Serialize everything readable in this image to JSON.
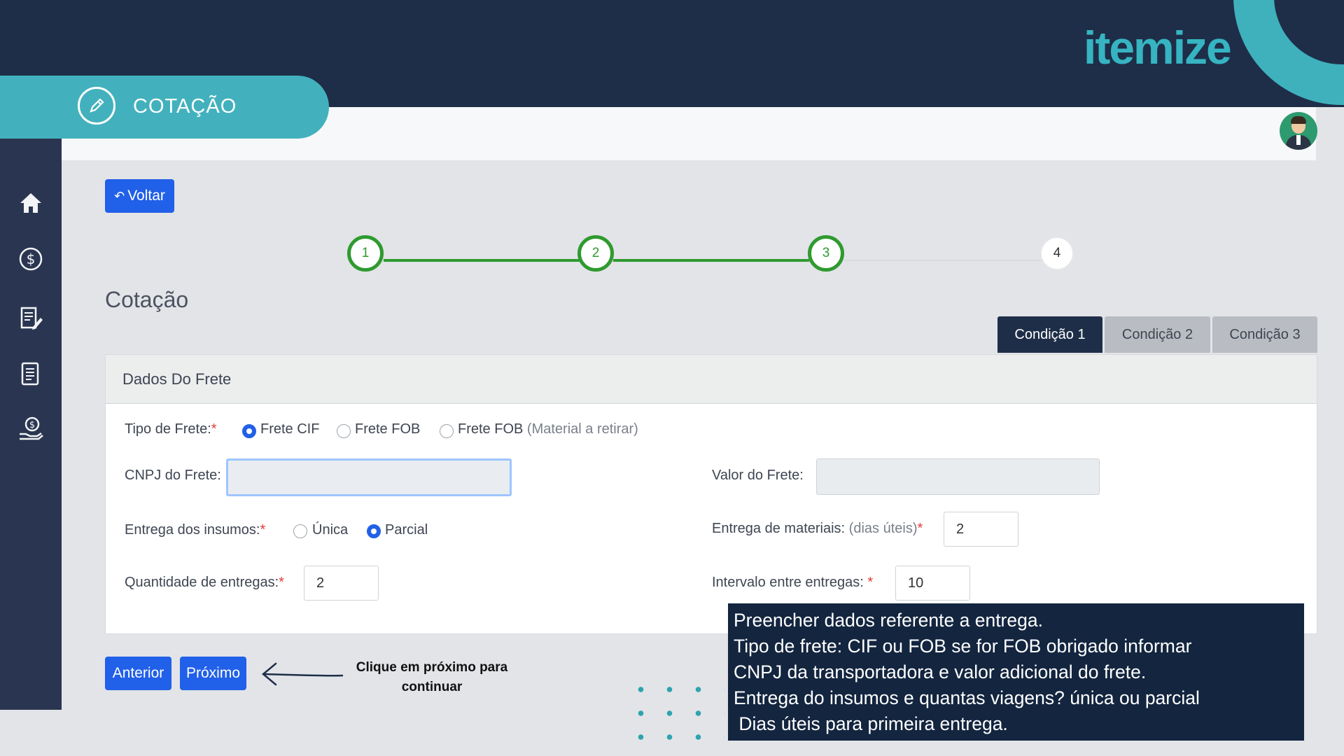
{
  "brand": {
    "logo_text": "itemize"
  },
  "section": {
    "title": "COTAÇÃO"
  },
  "nav": {
    "back_label": "Voltar"
  },
  "stepper": {
    "steps": [
      "1",
      "2",
      "3",
      "4"
    ],
    "current": 3
  },
  "page": {
    "title": "Cotação"
  },
  "tabs": [
    {
      "label": "Condição 1",
      "active": true
    },
    {
      "label": "Condição 2",
      "active": false
    },
    {
      "label": "Condição 3",
      "active": false
    }
  ],
  "form": {
    "title": "Dados Do Frete",
    "tipo_frete": {
      "label": "Tipo de Frete:",
      "required": "*",
      "options": [
        {
          "label": "Frete CIF",
          "selected": true
        },
        {
          "label": "Frete FOB",
          "selected": false
        },
        {
          "label": "Frete FOB",
          "note": "(Material a retirar)",
          "selected": false
        }
      ]
    },
    "cnpj": {
      "label": "CNPJ do Frete:",
      "value": ""
    },
    "valor": {
      "label": "Valor do Frete:",
      "value": ""
    },
    "entrega_insumos": {
      "label": "Entrega dos insumos:",
      "required": "*",
      "options": [
        {
          "label": "Única",
          "selected": false
        },
        {
          "label": "Parcial",
          "selected": true
        }
      ]
    },
    "entrega_materiais": {
      "label": "Entrega de materiais:",
      "note": "(dias úteis)",
      "required": "*",
      "value": "2"
    },
    "quantidade": {
      "label": "Quantidade de entregas:",
      "required": "*",
      "value": "2"
    },
    "intervalo": {
      "label": "Intervalo entre entregas:",
      "required": " *",
      "value": "10"
    }
  },
  "footer": {
    "prev_label": "Anterior",
    "next_label": "Próximo"
  },
  "annotation": {
    "text": "Clique em próximo para continuar"
  },
  "tip": {
    "lines": [
      "Preencher dados referente a entrega.",
      "Tipo de frete: CIF ou FOB se for FOB obrigado informar",
      "CNPJ da transportadora e valor adicional do frete.",
      "Entrega do insumos e quantas viagens? única ou parcial",
      " Dias úteis para primeira entrega."
    ]
  },
  "colors": {
    "navy": "#1e2e48",
    "teal": "#42b1bd",
    "primary": "#2160e8",
    "success": "#2f9a2f",
    "required": "#e33b3b"
  }
}
